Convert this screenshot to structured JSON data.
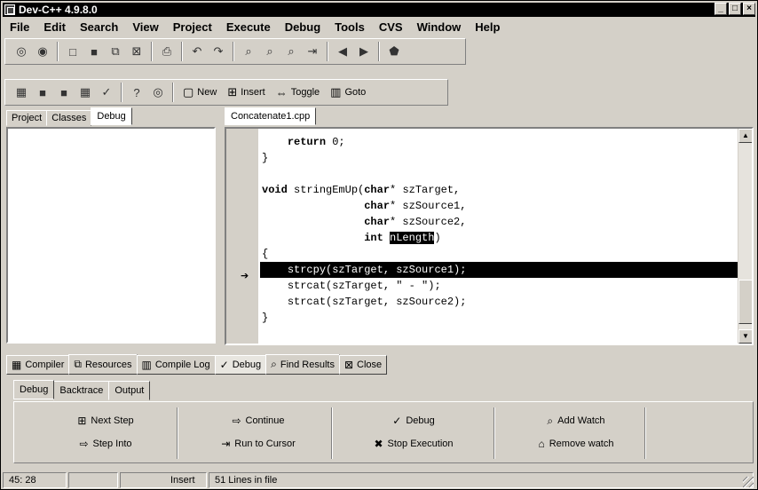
{
  "window": {
    "title": "Dev-C++ 4.9.8.0"
  },
  "menubar": [
    "File",
    "Edit",
    "Search",
    "View",
    "Project",
    "Execute",
    "Debug",
    "Tools",
    "CVS",
    "Window",
    "Help"
  ],
  "toolbar2": {
    "new_label": "New",
    "insert_label": "Insert",
    "toggle_label": "Toggle",
    "goto_label": "Goto"
  },
  "left_tabs": [
    "Project",
    "Classes",
    "Debug"
  ],
  "file_tab": "Concatenate1.cpp",
  "code": {
    "return_kw": "return",
    "return_rest": " 0;",
    "close_brace": "}",
    "void_kw": "void",
    "func_name": " stringEmUp(",
    "char_kw": "char",
    "p1": "* szTarget,",
    "p2": "* szSource1,",
    "p3": "* szSource2,",
    "int_kw": "int",
    "p4_selected": "nLength",
    "p4_close": ")",
    "open_brace": "{",
    "line_strcpy": "strcpy(szTarget, szSource1);",
    "line_strcat1": "strcat(szTarget, \" - \");",
    "line_strcat2": "strcat(szTarget, szSource2);",
    "close_brace2": "}"
  },
  "bottom_tabs": [
    "Compiler",
    "Resources",
    "Compile Log",
    "Debug",
    "Find Results",
    "Close"
  ],
  "debug_tabs": [
    "Debug",
    "Backtrace",
    "Output"
  ],
  "debug_buttons": {
    "next_step": "Next Step",
    "step_into": "Step Into",
    "continue": "Continue",
    "run_to_cursor": "Run to Cursor",
    "debug": "Debug",
    "stop_execution": "Stop Execution",
    "add_watch": "Add Watch",
    "remove_watch": "Remove watch"
  },
  "status": {
    "position": "45: 28",
    "mode": "Insert",
    "lines": "51 Lines in file"
  }
}
